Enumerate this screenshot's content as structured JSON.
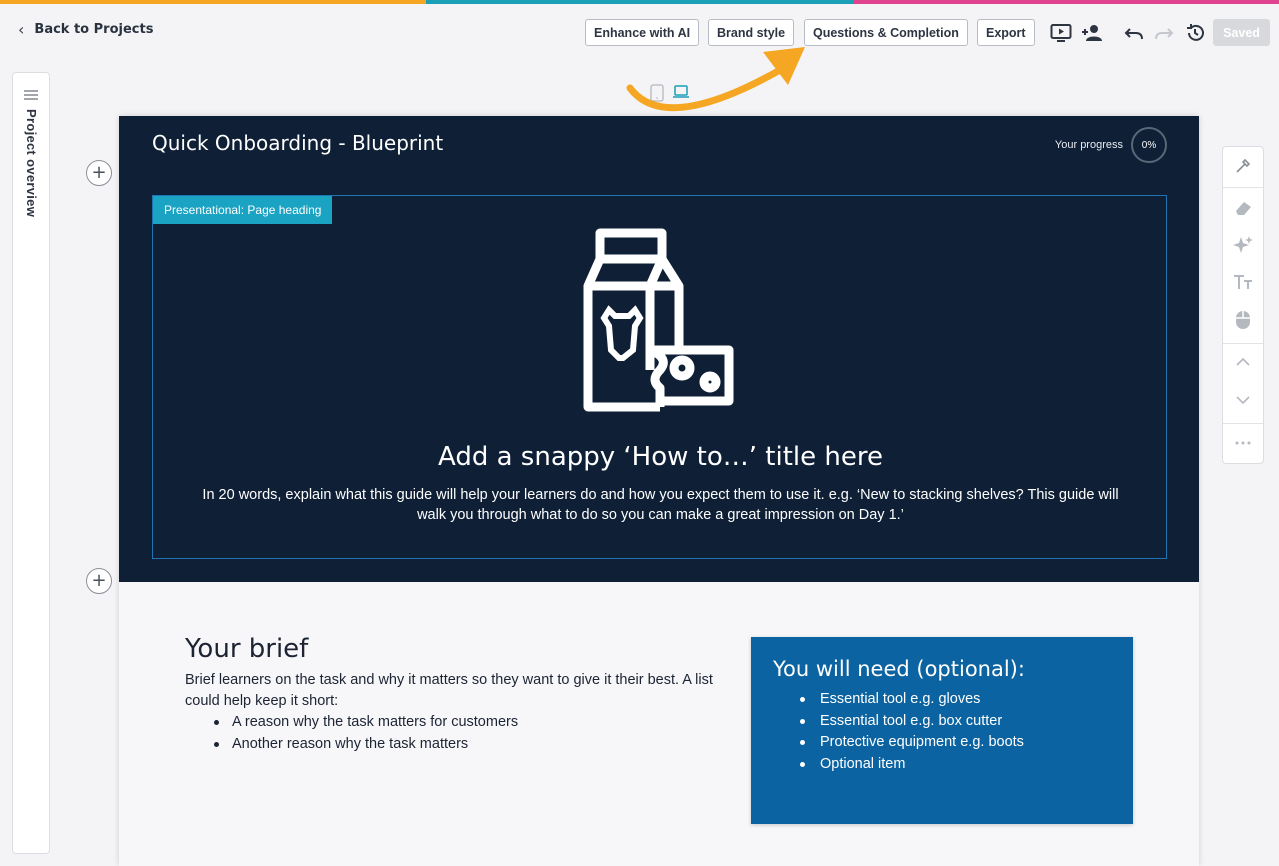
{
  "colors": {
    "stripe": [
      "#f5a623",
      "#1a9fb7",
      "#e0448e"
    ],
    "hero_bg": "#0e1f36",
    "accent": "#1aa3c2",
    "need_bg": "#0b63a1"
  },
  "topbar": {
    "back_label": "Back to Projects",
    "buttons": [
      "Enhance with AI",
      "Brand style",
      "Questions & Completion",
      "Export"
    ],
    "icons": [
      "preview-icon",
      "add-user-icon",
      "undo-icon",
      "redo-icon",
      "history-icon"
    ],
    "saved_label": "Saved"
  },
  "sidebar": {
    "label": "Project overview"
  },
  "canvas": {
    "course_title": "Quick Onboarding - Blueprint",
    "progress_label": "Your progress",
    "progress_value": "0%",
    "block_tag": "Presentational: Page heading",
    "hero_title": "Add a snappy ‘How to…’ title here",
    "hero_description": "In 20 words, explain what this guide will help your learners do and how you expect them to use it. e.g. ‘New to stacking shelves? This guide will walk you through what to do so you can make a great impression on Day 1.’"
  },
  "brief": {
    "heading": "Your brief",
    "text": "Brief learners on the task and why it matters so they want to give it their best. A list could help keep it short:",
    "items": [
      "A reason why the task matters for customers",
      "Another reason why the task matters"
    ]
  },
  "need": {
    "heading": "You will need (optional):",
    "items": [
      "Essential tool e.g. gloves",
      "Essential tool e.g. box cutter",
      "Protective equipment e.g. boots",
      "Optional item"
    ]
  },
  "right_tools": [
    "eyedropper-icon",
    "eraser-icon",
    "sparkle-icon",
    "text-size-icon",
    "mouse-icon",
    "chevron-up-icon",
    "chevron-down-icon",
    "more-icon"
  ]
}
